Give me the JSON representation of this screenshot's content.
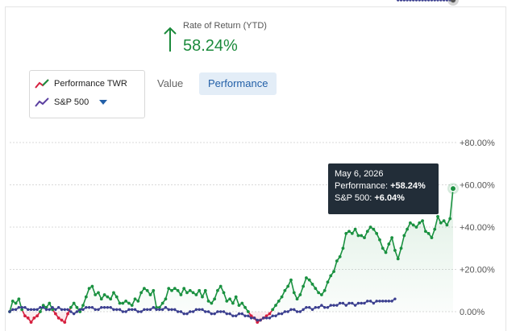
{
  "header": {
    "rate_label": "Rate of Return (YTD)",
    "rate_value": "58.24%",
    "rate_color": "#1b8a3b"
  },
  "legend": {
    "items": [
      {
        "label": "Performance TWR",
        "icon": "trend-line-red-green-icon"
      },
      {
        "label": "S&P 500",
        "icon": "trend-line-purple-icon"
      }
    ],
    "dropdown_icon": "caret-down-icon"
  },
  "tabs": [
    {
      "label": "Value",
      "active": false
    },
    {
      "label": "Performance",
      "active": true
    }
  ],
  "tooltip": {
    "date": "May 6, 2026",
    "performance_label": "Performance: ",
    "performance_value": "+58.24%",
    "sp_label": "S&P 500: ",
    "sp_value": "+6.04%"
  },
  "colors": {
    "performance_positive": "#1a9140",
    "performance_negative": "#d6203f",
    "sp500": "#3b3f8f",
    "tab_active_bg": "#e3edf7",
    "tab_active_text": "#2360a8"
  },
  "chart_data": {
    "type": "line",
    "y_tick_labels": [
      "+80.00%",
      "+60.00%",
      "+40.00%",
      "+20.00%",
      "0.00%"
    ],
    "y_ticks": [
      80,
      60,
      40,
      20,
      0
    ],
    "ylim": [
      -5,
      85
    ],
    "grid": true,
    "series": [
      {
        "name": "Performance TWR",
        "values": [
          0,
          5,
          4,
          6,
          1,
          -2,
          -3,
          -5,
          -3,
          -2,
          0,
          3,
          2,
          4,
          1,
          -1,
          -3,
          -4,
          -5,
          -1,
          2,
          4,
          2,
          0,
          3,
          7,
          11,
          12,
          8,
          9,
          6,
          8,
          7,
          6,
          9,
          7,
          4,
          4,
          5,
          4,
          3,
          6,
          5,
          9,
          11,
          10,
          8,
          10,
          2,
          2,
          4,
          6,
          11,
          10,
          11,
          10,
          8,
          11,
          9,
          10,
          9,
          8,
          10,
          7,
          10,
          5,
          4,
          6,
          10,
          12,
          9,
          5,
          6,
          4,
          7,
          3,
          4,
          2,
          0,
          -2,
          -3,
          -5,
          -4,
          -3,
          -2,
          -1,
          1,
          3,
          5,
          7,
          10,
          12,
          15,
          9,
          6,
          8,
          12,
          16,
          15,
          13,
          11,
          9,
          8,
          10,
          14,
          17,
          19,
          24,
          26,
          30,
          37,
          38,
          37,
          39,
          36,
          36,
          35,
          38,
          40,
          39,
          37,
          34,
          30,
          28,
          32,
          35,
          29,
          25,
          30,
          36,
          39,
          42,
          41,
          40,
          42,
          43,
          38,
          37,
          35,
          39,
          45,
          42,
          43,
          41,
          44,
          58.24
        ],
        "segment_markers": [
          14,
          21,
          79,
          86
        ]
      },
      {
        "name": "S&P 500",
        "values": [
          0,
          1,
          1,
          2,
          2,
          2,
          1,
          1,
          1,
          1,
          2,
          2,
          1,
          1,
          2,
          1,
          2,
          1,
          1,
          1,
          0,
          -1,
          0,
          1,
          1,
          2,
          2,
          2,
          1,
          1,
          2,
          2,
          2,
          2,
          1,
          1,
          1,
          0,
          0,
          1,
          1,
          1,
          0,
          0,
          1,
          1,
          1,
          2,
          1,
          1,
          1,
          2,
          1,
          1,
          1,
          0,
          0,
          -1,
          -1,
          0,
          0,
          1,
          1,
          1,
          0,
          0,
          -1,
          -1,
          0,
          0,
          0,
          -1,
          -1,
          -2,
          -2,
          -1,
          -1,
          -2,
          -2,
          -3,
          -3,
          -4,
          -4,
          -3,
          -3,
          -3,
          -2,
          -2,
          -1,
          -1,
          0,
          0,
          1,
          1,
          0,
          0,
          1,
          2,
          2,
          1,
          2,
          2,
          3,
          2,
          2,
          3,
          3,
          3,
          4,
          4,
          3,
          4,
          4,
          3,
          4,
          4,
          4,
          5,
          5,
          4,
          5,
          5,
          5,
          5,
          5,
          5,
          6.04
        ]
      }
    ],
    "highlight": {
      "date": "May 6, 2026",
      "performance": 58.24,
      "sp500": 6.04
    }
  }
}
